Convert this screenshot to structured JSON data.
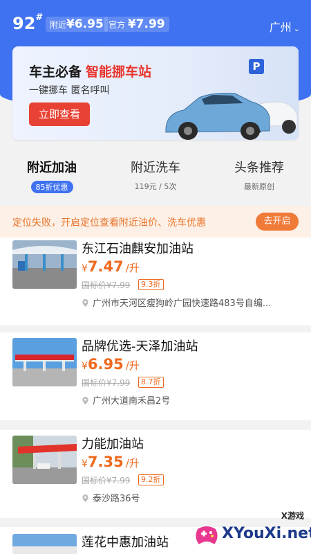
{
  "header": {
    "fuel_grade": "92",
    "fuel_grade_mark": "#",
    "nearby_label": "附近",
    "nearby_price": "¥6.95",
    "official_label": "官方",
    "official_price": "¥7.99",
    "city": "广州",
    "city_icon": "chevron-down-icon"
  },
  "banner": {
    "title_black": "车主必备",
    "title_red": "智能挪车站",
    "subtitle": "一键挪车 匿名呼叫",
    "button": "立即查看",
    "parking_sign": "P"
  },
  "tabs": [
    {
      "label": "附近加油",
      "sub": "85折优惠"
    },
    {
      "label": "附近洗车",
      "sub": "119元 / 5次"
    },
    {
      "label": "头条推荐",
      "sub": "最新原创"
    }
  ],
  "notice": {
    "text": "定位失败，开启定位查看附近油价、洗车优惠",
    "button": "去开启"
  },
  "stations": [
    {
      "name": "东江石油麒安加油站",
      "currency": "¥",
      "price": "7.47",
      "unit": "/升",
      "original": "国标价¥7.99",
      "discount": "9.3折",
      "address": "广州市天河区瘦狗岭广园快速路483号自编..."
    },
    {
      "name": "品牌优选-天泽加油站",
      "currency": "¥",
      "price": "6.95",
      "unit": "/升",
      "original": "国标价¥7.99",
      "discount": "8.7折",
      "address": "广州大道南禾昌2号"
    },
    {
      "name": "力能加油站",
      "currency": "¥",
      "price": "7.35",
      "unit": "/升",
      "original": "国标价¥7.99",
      "discount": "9.2折",
      "address": "泰沙路36号"
    },
    {
      "name": "莲花中惠加油站"
    }
  ],
  "watermark": {
    "small": "X游戏",
    "main": "XYouXi.net"
  },
  "colors": {
    "primary_blue": "#3f72f0",
    "accent_red": "#e84235",
    "price_orange": "#ee6a1f",
    "notice_bg": "#fdf0e6"
  }
}
